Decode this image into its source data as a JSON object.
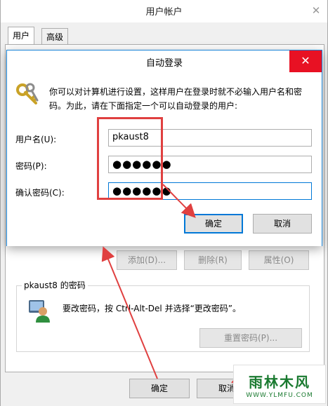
{
  "background_window": {
    "title": "用户帐户",
    "close_symbol": "✕",
    "tabs": [
      {
        "label": "用户",
        "active": true
      },
      {
        "label": "高级",
        "active": false
      }
    ],
    "buttons": {
      "add": "添加(D)...",
      "remove": "删除(R)",
      "properties": "属性(O)"
    },
    "password_group": {
      "legend": "pkaust8 的密码",
      "text": "要改密码，按 Ctrl-Alt-Del 并选择“更改密码”。",
      "reset_button": "重置密码(P)..."
    },
    "footer": {
      "ok": "确定",
      "cancel": "取消"
    }
  },
  "dialog": {
    "title": "自动登录",
    "close_symbol": "✕",
    "description": "你可以对计算机进行设置，这样用户在登录时就不必输入用户名和密码。为此，请在下面指定一个可以自动登录的用户:",
    "fields": {
      "username_label": "用户名(U):",
      "username_value": "pkaust8",
      "password_label": "密码(P):",
      "password_value": "●●●●●●",
      "confirm_label": "确认密码(C):",
      "confirm_value": "●●●●●●"
    },
    "ok": "确定",
    "cancel": "取消"
  },
  "watermark": {
    "title": "雨林木风",
    "url": "WWW.YLMFU.COM"
  },
  "colors": {
    "accent": "#0078d7",
    "close_red": "#e81123",
    "annotation_red": "#e04040",
    "watermark_green": "#1a7a30"
  },
  "icons": [
    "keys-icon",
    "password-user-icon",
    "close-icon"
  ]
}
